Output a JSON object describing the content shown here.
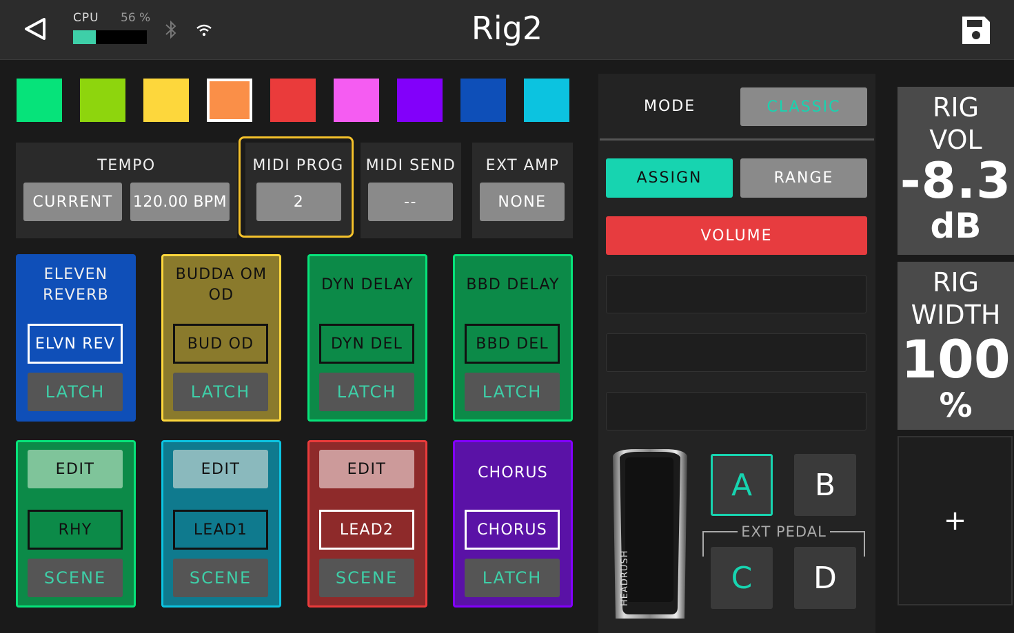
{
  "header": {
    "title": "Rig2",
    "cpu_label": "CPU",
    "cpu_percent_text": "56 %",
    "cpu_percent": 56
  },
  "swatches": [
    {
      "color": "#06e37a",
      "selected": false
    },
    {
      "color": "#8ed50d",
      "selected": false
    },
    {
      "color": "#fdd73c",
      "selected": false
    },
    {
      "color": "#fa8f48",
      "selected": true
    },
    {
      "color": "#ea3b3b",
      "selected": false
    },
    {
      "color": "#f55cf2",
      "selected": false
    },
    {
      "color": "#8200fa",
      "selected": false
    },
    {
      "color": "#0e4fb8",
      "selected": false
    },
    {
      "color": "#0cc3e0",
      "selected": false
    }
  ],
  "settings": {
    "tempo_label": "TEMPO",
    "tempo_mode": "CURRENT",
    "tempo_value": "120.00 BPM",
    "midi_prog_label": "MIDI PROG",
    "midi_prog_value": "2",
    "midi_send_label": "MIDI SEND",
    "midi_send_value": "--",
    "ext_amp_label": "EXT AMP",
    "ext_amp_value": "NONE"
  },
  "tiles_row1": [
    {
      "name": "ELEVEN REVERB",
      "tag": "ELVN REV",
      "mode": "LATCH"
    },
    {
      "name": "BUDDA OM OD",
      "tag": "BUD OD",
      "mode": "LATCH"
    },
    {
      "name": "DYN DELAY",
      "tag": "DYN DEL",
      "mode": "LATCH"
    },
    {
      "name": "BBD DELAY",
      "tag": "BBD DEL",
      "mode": "LATCH"
    }
  ],
  "tiles_row2": [
    {
      "top": "EDIT",
      "tag": "RHY",
      "mode": "SCENE"
    },
    {
      "top": "EDIT",
      "tag": "LEAD1",
      "mode": "SCENE"
    },
    {
      "top": "EDIT",
      "tag": "LEAD2",
      "mode": "SCENE"
    },
    {
      "top": "CHORUS",
      "tag": "CHORUS",
      "mode": "LATCH"
    }
  ],
  "pedal_panel": {
    "mode_label": "MODE",
    "mode_value": "CLASSIC",
    "assign_label": "ASSIGN",
    "range_label": "RANGE",
    "volume_label": "VOLUME",
    "pedal_brand": "HEADRUSH",
    "footswitch_a": "A",
    "footswitch_b": "B",
    "footswitch_c": "C",
    "footswitch_d": "D",
    "ext_pedal_label": "EXT PEDAL"
  },
  "rig": {
    "vol_label_1": "RIG",
    "vol_label_2": "VOL",
    "vol_value": "-8.3",
    "vol_unit": "dB",
    "width_label_1": "RIG",
    "width_label_2": "WIDTH",
    "width_value": "100",
    "width_unit": "%",
    "add_label": "+"
  },
  "colors": {
    "accent": "#17d4b0",
    "volume": "#e73c3f",
    "highlight": "#f5c22b"
  },
  "icons": [
    "back-icon",
    "bluetooth-icon",
    "wifi-icon",
    "save-icon"
  ]
}
